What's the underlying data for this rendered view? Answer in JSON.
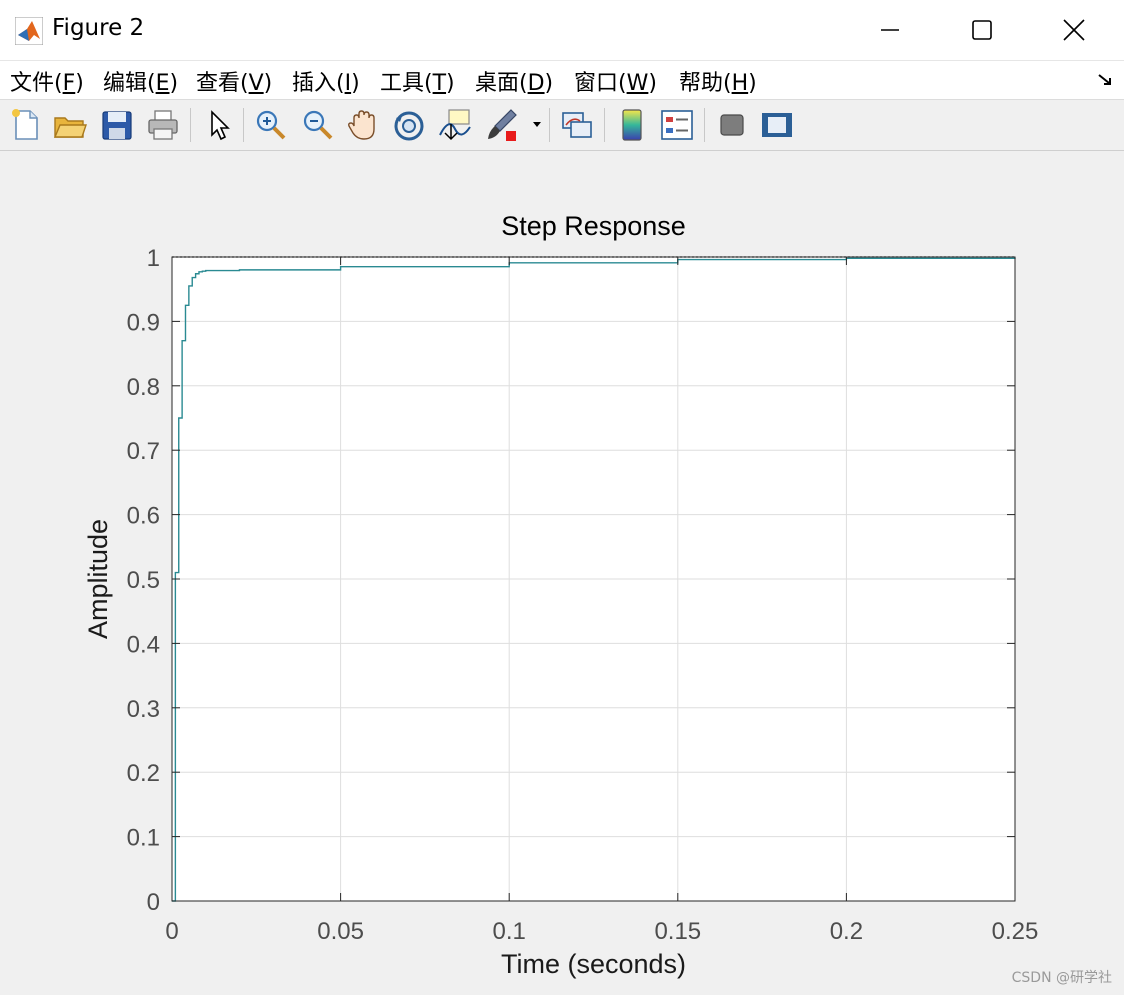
{
  "window": {
    "title": "Figure 2",
    "minimize_icon": "minimize-icon",
    "maximize_icon": "maximize-icon",
    "close_icon": "close-icon"
  },
  "menu": [
    {
      "label": "文件(",
      "key": "F",
      "suffix": ")"
    },
    {
      "label": "编辑(",
      "key": "E",
      "suffix": ")"
    },
    {
      "label": "查看(",
      "key": "V",
      "suffix": ")"
    },
    {
      "label": "插入(",
      "key": "I",
      "suffix": ")"
    },
    {
      "label": "工具(",
      "key": "T",
      "suffix": ")"
    },
    {
      "label": "桌面(",
      "key": "D",
      "suffix": ")"
    },
    {
      "label": "窗口(",
      "key": "W",
      "suffix": ")"
    },
    {
      "label": "帮助(",
      "key": "H",
      "suffix": ")"
    }
  ],
  "toolbar": [
    "new-figure-icon",
    "open-file-icon",
    "save-icon",
    "print-icon",
    "select-arrow-icon",
    "zoom-in-icon",
    "zoom-out-icon",
    "pan-hand-icon",
    "rotate-3d-icon",
    "data-cursor-icon",
    "brush-icon",
    "link-plot-icon",
    "colorbar-icon",
    "legend-icon",
    "hide-plot-tools-icon",
    "show-plot-tools-icon"
  ],
  "colors": {
    "line": "#2a8a92",
    "grid": "#dedede",
    "axes": "#262626"
  },
  "chart_data": {
    "type": "line",
    "title": "Step Response",
    "xlabel": "Time (seconds)",
    "ylabel": "Amplitude",
    "xlim": [
      0,
      0.25
    ],
    "ylim": [
      0,
      1
    ],
    "xticks": [
      "0",
      "0.05",
      "0.1",
      "0.15",
      "0.2",
      "0.25"
    ],
    "yticks": [
      "0",
      "0.1",
      "0.2",
      "0.3",
      "0.4",
      "0.5",
      "0.6",
      "0.7",
      "0.8",
      "0.9",
      "1"
    ],
    "grid": true,
    "steady_state": 1,
    "series": [
      {
        "style": "stairs",
        "x": [
          0,
          0.001,
          0.002,
          0.003,
          0.004,
          0.005,
          0.006,
          0.007,
          0.008,
          0.009,
          0.01,
          0.02,
          0.05,
          0.1,
          0.15,
          0.2,
          0.25
        ],
        "y": [
          0,
          0.51,
          0.75,
          0.87,
          0.925,
          0.955,
          0.968,
          0.974,
          0.977,
          0.978,
          0.979,
          0.98,
          0.985,
          0.991,
          0.996,
          0.998,
          0.999
        ]
      }
    ]
  },
  "watermark": "CSDN @研学社"
}
